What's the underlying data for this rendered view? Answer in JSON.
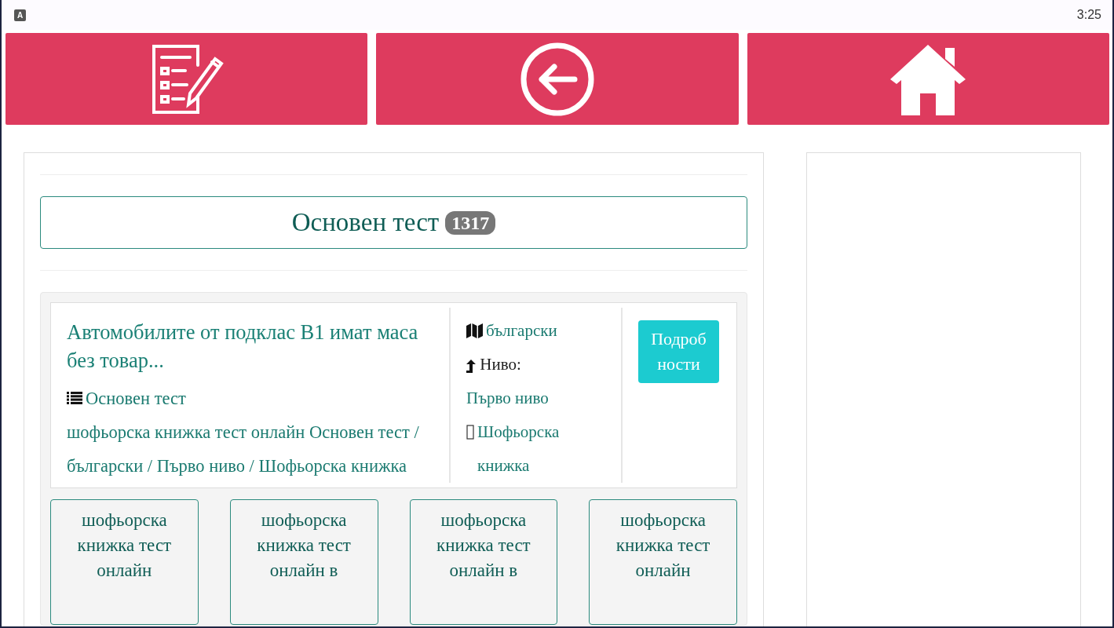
{
  "status_bar": {
    "app_icon": "A",
    "time": "3:25"
  },
  "toolbar": [
    {
      "kind": "checklist"
    },
    {
      "kind": "back"
    },
    {
      "kind": "home"
    }
  ],
  "heading": {
    "title": "Основен тест",
    "count": "1317"
  },
  "result": {
    "title": "Автомобилите от подклас B1 имат маса без товар...",
    "category": "Основен тест",
    "breadcrumb": "шофьорска книжка тест онлайн Основен тест / български / Първо ниво / Шофьорска книжка",
    "language": "български",
    "level_label": "Ниво:",
    "level_value": "Първо ниво",
    "license": "Шофьорска книжка",
    "details_button": "Подробности"
  },
  "tags": [
    "шофьорска книжка тест онлайн",
    "шофьорска книжка тест онлайн в",
    "шофьорска книжка тест онлайн в",
    "шофьорска книжка тест онлайн"
  ]
}
